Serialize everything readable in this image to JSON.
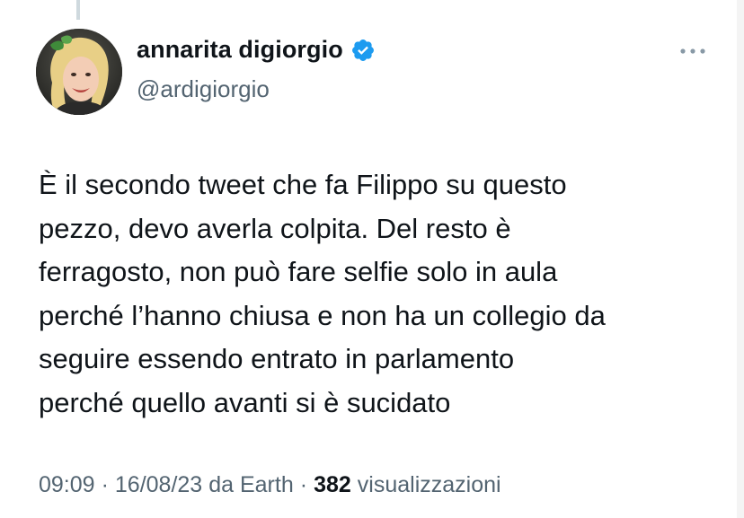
{
  "tweet": {
    "author": {
      "display_name": "annarita digiorgio",
      "handle": "@ardigiorgio",
      "verified": true,
      "verified_color": "#1d9bf0"
    },
    "text": "È il secondo tweet che fa Filippo su questo\npezzo, devo averla colpita. Del resto è\nferragosto, non può fare selfie solo in aula\nperché l’hanno chiusa e non ha un collegio da\nseguire essendo entrato in parlamento\nperché quello avanti si è sucidato",
    "meta": {
      "time": "09:09",
      "separator": "·",
      "date": "16/08/23",
      "source": "da Earth",
      "views_count": "382",
      "views_label": "visualizzazioni"
    },
    "icons": {
      "avatar": "avatar-photo",
      "verified": "verified-badge-icon",
      "more": "more-options-icon"
    }
  }
}
